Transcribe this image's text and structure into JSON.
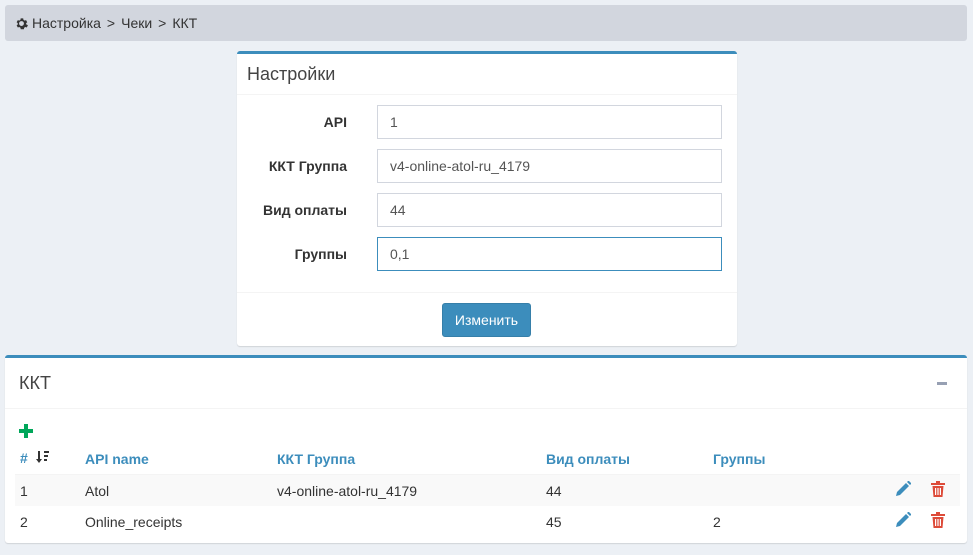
{
  "breadcrumb": {
    "icon": "gear-icon",
    "items": [
      "Настройка",
      "Чеки",
      "ККТ"
    ],
    "separator": ">"
  },
  "settings": {
    "title": "Настройки",
    "fields": [
      {
        "label": "API",
        "value": "1"
      },
      {
        "label": "ККТ Группа",
        "value": "v4-online-atol-ru_4179"
      },
      {
        "label": "Вид оплаты",
        "value": "44"
      },
      {
        "label": "Группы",
        "value": "0,1"
      }
    ],
    "submit_label": "Изменить"
  },
  "kkt": {
    "title": "ККТ",
    "columns": [
      "#",
      "API name",
      "ККТ Группа",
      "Вид оплаты",
      "Группы"
    ],
    "rows": [
      {
        "num": "1",
        "api_name": "Atol",
        "group": "v4-online-atol-ru_4179",
        "payment": "44",
        "groups": ""
      },
      {
        "num": "2",
        "api_name": "Online_receipts",
        "group": "",
        "payment": "45",
        "groups": "2"
      }
    ]
  },
  "colors": {
    "accent": "#3c8dbc",
    "add": "#00a65a",
    "delete": "#dd4b39",
    "background": "#ecf0f5"
  }
}
